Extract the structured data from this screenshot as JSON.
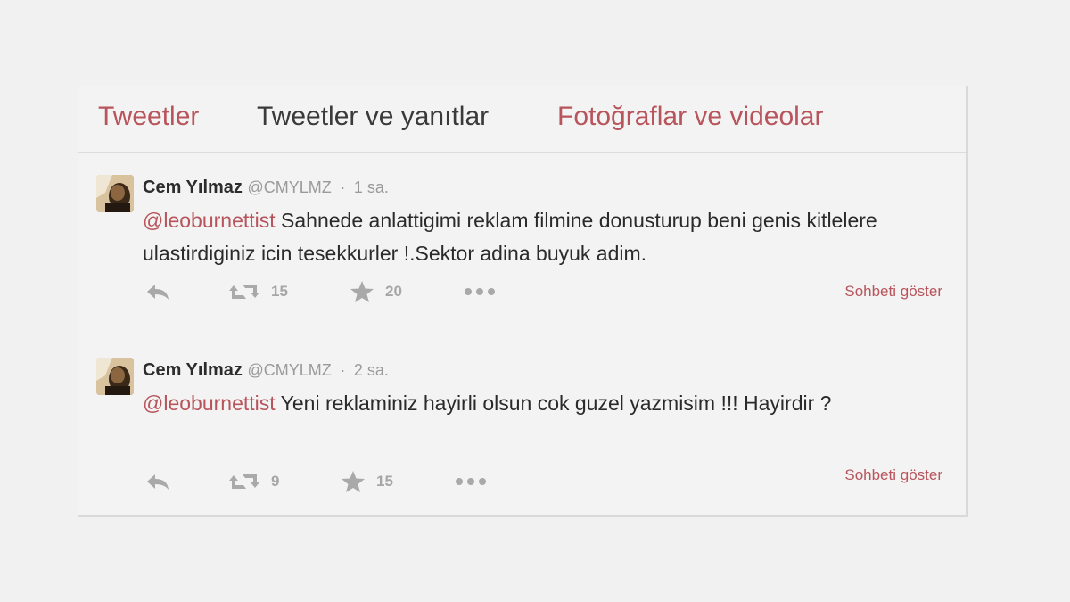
{
  "tabs": [
    {
      "label": "Tweetler",
      "color": "#b8545b"
    },
    {
      "label": "Tweetler ve yanıtlar",
      "color": "#3a3a3a"
    },
    {
      "label": "Fotoğraflar ve videolar",
      "color": "#b8545b"
    }
  ],
  "tweets": [
    {
      "name": "Cem Yılmaz",
      "handle": "@CMYLMZ",
      "separator": "·",
      "time": "1 sa.",
      "mention": "@leoburnettist",
      "text": " Sahnede anlattigimi reklam filmine donusturup beni genis kitlelere ulastirdiginiz icin tesekkurler !.Sektor adina buyuk adim.",
      "retweets": "15",
      "favorites": "20",
      "show_conversation": "Sohbeti göster"
    },
    {
      "name": "Cem Yılmaz",
      "handle": "@CMYLMZ",
      "separator": "·",
      "time": "2 sa.",
      "mention": "@leoburnettist",
      "text": " Yeni reklaminiz hayirli olsun cok guzel yazmisim !!! Hayirdir ?",
      "retweets": "9",
      "favorites": "15",
      "show_conversation": "Sohbeti göster"
    }
  ],
  "icons": {
    "reply": "reply-icon",
    "retweet": "retweet-icon",
    "favorite": "star-icon",
    "more": "more-icon"
  },
  "colors": {
    "accent": "#b8545b",
    "muted": "#a6a6a6",
    "background": "#f1f1f1"
  }
}
